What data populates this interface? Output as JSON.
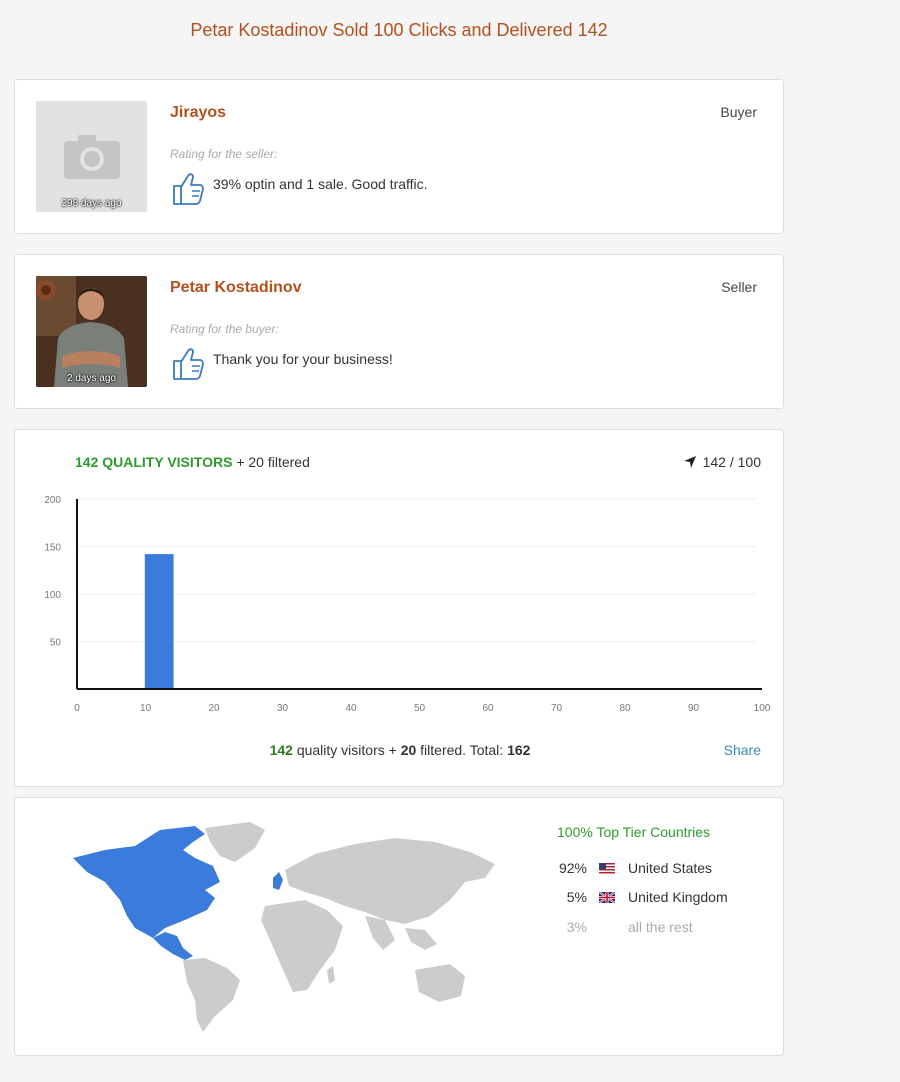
{
  "page_title": "Petar Kostadinov Sold 100 Clicks and Delivered 142",
  "reviews": [
    {
      "name": "Jirayos",
      "role": "Buyer",
      "time": "298 days ago",
      "rating_label": "Rating for the seller:",
      "comment": "39% optin and 1 sale. Good traffic.",
      "rating_icon": "thumbs-up-icon"
    },
    {
      "name": "Petar Kostadinov",
      "role": "Seller",
      "time": "2 days ago",
      "rating_label": "Rating for the buyer:",
      "comment": "Thank you for your business!",
      "rating_icon": "thumbs-up-icon"
    }
  ],
  "visitors": {
    "quality_label": "142 QUALITY VISITORS",
    "filtered_label": "+ 20 filtered",
    "delivered_ratio": "142 / 100",
    "footer": {
      "quality": "142",
      "quality_text": "quality visitors +",
      "filtered": "20",
      "filtered_text": "filtered. Total:",
      "total": "162"
    },
    "share_label": "Share"
  },
  "chart_data": {
    "type": "bar",
    "x": [
      12
    ],
    "values": [
      142
    ],
    "xlim": [
      0,
      100
    ],
    "ylim": [
      0,
      200
    ],
    "x_ticks": [
      0,
      10,
      20,
      30,
      40,
      50,
      60,
      70,
      80,
      90,
      100
    ],
    "y_ticks": [
      50,
      100,
      150,
      200
    ],
    "bar_color": "#3a7bdc",
    "grid": true
  },
  "geo": {
    "top_tier_label": "100% Top Tier Countries",
    "countries": [
      {
        "pct": "92%",
        "name": "United States",
        "flag": "us-flag-icon"
      },
      {
        "pct": "5%",
        "name": "United Kingdom",
        "flag": "uk-flag-icon"
      },
      {
        "pct": "3%",
        "name": "all the rest",
        "flag": ""
      }
    ],
    "highlight_color": "#3a7bdc",
    "land_color": "#cccccc"
  },
  "colors": {
    "accent": "#b5501e",
    "green": "#2e9b2e",
    "link": "#3a8ab5"
  }
}
